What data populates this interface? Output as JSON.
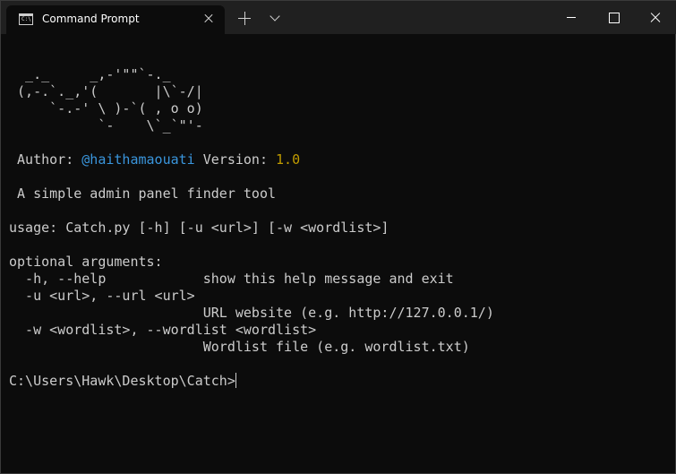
{
  "window": {
    "tab_icon": "command-prompt-icon",
    "tab_icon_text": "C:\\",
    "tab_title": "Command Prompt",
    "controls": [
      "minimize-icon",
      "maximize-icon",
      "close-icon"
    ]
  },
  "terminal": {
    "art": [
      "  _._     _,-'\"\"`-._",
      " (,-.`._,'(       |\\`-/|",
      "     `-.-' \\ )-`( , o o)",
      "           `-    \\`_`\"'-"
    ],
    "author_label": " Author: ",
    "author_handle": "@haithamaouati",
    "version_label": " Version: ",
    "version_value": "1.0",
    "description": " A simple admin panel finder tool",
    "usage": "usage: Catch.py [-h] [-u <url>] [-w <wordlist>]",
    "options_header": "optional arguments:",
    "options": [
      "  -h, --help            show this help message and exit",
      "  -u <url>, --url <url>",
      "                        URL website (e.g. http://127.0.0.1/)",
      "  -w <wordlist>, --wordlist <wordlist>",
      "                        Wordlist file (e.g. wordlist.txt)"
    ],
    "prompt": "C:\\Users\\Hawk\\Desktop\\Catch>"
  },
  "colors": {
    "background": "#0c0c0c",
    "titlebar": "#202020",
    "text": "#cccccc",
    "handle": "#3a96dd",
    "version": "#c19c00"
  }
}
